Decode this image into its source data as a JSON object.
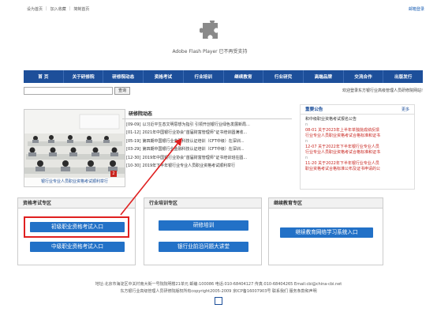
{
  "top": {
    "links": [
      "设为首页",
      "加入收藏",
      "简制首页"
    ],
    "mail_login": "邮箱登录"
  },
  "flash": {
    "message": "Adobe Flash Player 已不再受支持"
  },
  "nav": {
    "items": [
      "首 页",
      "关于研修院",
      "研修院动态",
      "资格考试",
      "行业培训",
      "继续教育",
      "行业研究",
      "高端品牌",
      "交流合作",
      "出版发行"
    ]
  },
  "search": {
    "button_label": "查询",
    "placeholder": ""
  },
  "welcome": "欢迎登录东方银行业高级管理人员研修院网站!",
  "carousel": {
    "caption": "银行业专业人员职业资格考试顺利举行",
    "index": "2"
  },
  "news": {
    "title": "研修院动态",
    "items": [
      {
        "date": "[09-09]",
        "text": "以习近平生态文明思想为指引 引领开创银行业绿色发展新局..."
      },
      {
        "date": "[01-12]",
        "text": "2021年中国银行业协会“首届财富管理师”证书培训圆满收..."
      },
      {
        "date": "[05-19]",
        "text": "第四期中国银行业金融科技认证培训（CFT中级）在深圳..."
      },
      {
        "date": "[03-29]",
        "text": "第四期中国银行业金融科技认证培训（CFT中级）在深圳..."
      },
      {
        "date": "[12-30]",
        "text": "2019年中国银行业协会“首届财富管理师”证书培训班在圆..."
      },
      {
        "date": "[10-30]",
        "text": "2019年下半年银行业专业人员职业资格考试顺利举行"
      }
    ]
  },
  "notice": {
    "title": "重要公告",
    "more": "更多",
    "rows": [
      {
        "style": "",
        "text": "和中级职业资格考试报名公告"
      },
      {
        "style": "dot",
        "text": "n"
      },
      {
        "style": "red",
        "text": "08-01  关于2023年上半年单独批成绩反馈"
      },
      {
        "style": "red",
        "text": "行业专业人员职业资格考试合格标准和证书"
      },
      {
        "style": "dot",
        "text": "n"
      },
      {
        "style": "red",
        "text": "12-07  关于2022年下半年银行业专业人员"
      },
      {
        "style": "red",
        "text": "行业专业人员职业资格考试合格标准和证书"
      },
      {
        "style": "dot",
        "text": "n"
      },
      {
        "style": "red",
        "text": "11-20  关于2022年下半年银行业专业人员"
      },
      {
        "style": "red",
        "text": "职业资格考试合格标准公布及证书申请的公"
      }
    ]
  },
  "zones": {
    "exam": {
      "title": "资格考试专区",
      "btn_primary": "初级职业资格考试入口",
      "btn_secondary": "中级职业资格考试入口"
    },
    "training": {
      "title": "行业培训专区",
      "btn_primary": "研修培训",
      "btn_secondary": "银行业前沿问题大讲堂"
    },
    "education": {
      "title": "继续教育专区",
      "btn_primary": "继续教育网络学习系统入口"
    }
  },
  "footer": {
    "line1": "地址:北京市海淀区中关村南大街一号院院明楼21单元 邮编:100086 电话:010-68404127 传真:010-68404265 Email:cbi@china-cbi.net",
    "line2": "东方银行业高级管理人员研修院版权所有copyright2005-2009 京ICP备16007903号 联系我们 服务条款和声明"
  },
  "colors": {
    "nav": "#1d4f9a",
    "button": "#2271c7",
    "highlight": "#e02020"
  }
}
